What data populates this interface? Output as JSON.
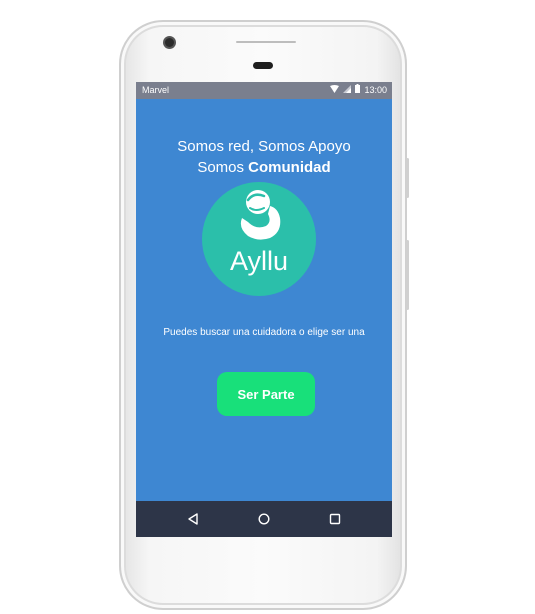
{
  "statusbar": {
    "carrier": "Marvel",
    "time": "13:00",
    "icons": [
      "wifi-icon",
      "signal-icon",
      "battery-icon"
    ]
  },
  "header": {
    "line1": "Somos red, Somos Apoyo",
    "line2_prefix": "Somos ",
    "line2_bold": "Comunidad"
  },
  "logo": {
    "text": "Ayllu",
    "color": "#2bbfaa"
  },
  "subtitle": "Puedes buscar una cuidadora o elige ser una",
  "cta": {
    "label": "Ser Parte",
    "color": "#18e07a"
  },
  "navbar": {
    "items": [
      "back-icon",
      "home-icon",
      "recents-icon"
    ]
  },
  "colors": {
    "screen_bg": "#3e87d2",
    "statusbar_bg": "#7a7f8e",
    "navbar_bg": "#2d3548"
  }
}
